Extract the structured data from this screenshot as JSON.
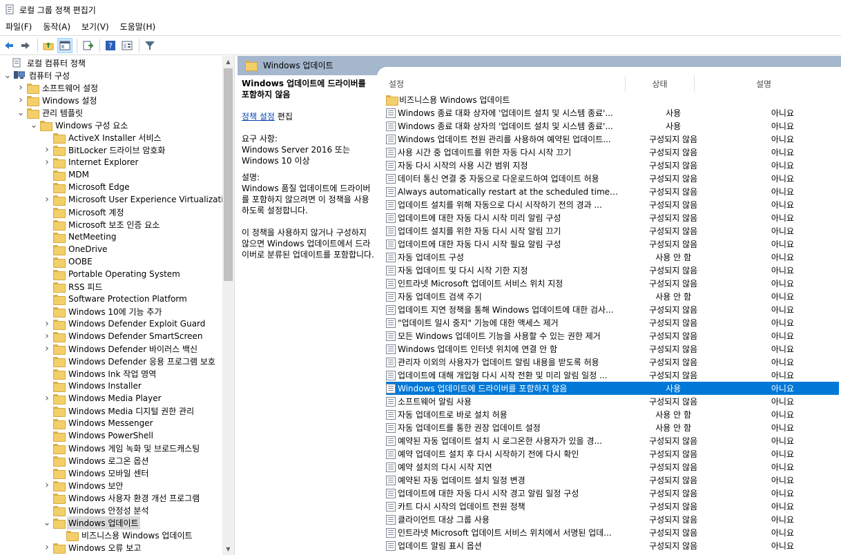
{
  "window": {
    "title": "로컬 그룹 정책 편집기"
  },
  "menu": [
    "파일(F)",
    "동작(A)",
    "보기(V)",
    "도움말(H)"
  ],
  "tree": [
    {
      "label": "로컬 컴퓨터 정책",
      "indent": 0,
      "exp": "",
      "icon": "policy"
    },
    {
      "label": "컴퓨터 구성",
      "indent": 1,
      "exp": "v",
      "icon": "computer"
    },
    {
      "label": "소프트웨어 설정",
      "indent": 2,
      "exp": ">",
      "icon": "folder"
    },
    {
      "label": "Windows 설정",
      "indent": 2,
      "exp": ">",
      "icon": "folder"
    },
    {
      "label": "관리 템플릿",
      "indent": 2,
      "exp": "v",
      "icon": "folder"
    },
    {
      "label": "Windows 구성 요소",
      "indent": 3,
      "exp": "v",
      "icon": "folder"
    },
    {
      "label": "ActiveX Installer 서비스",
      "indent": 4,
      "exp": "",
      "icon": "folder"
    },
    {
      "label": "BitLocker 드라이브 암호화",
      "indent": 4,
      "exp": ">",
      "icon": "folder"
    },
    {
      "label": "Internet Explorer",
      "indent": 4,
      "exp": ">",
      "icon": "folder"
    },
    {
      "label": "MDM",
      "indent": 4,
      "exp": "",
      "icon": "folder"
    },
    {
      "label": "Microsoft Edge",
      "indent": 4,
      "exp": "",
      "icon": "folder"
    },
    {
      "label": "Microsoft User Experience Virtualization",
      "indent": 4,
      "exp": ">",
      "icon": "folder"
    },
    {
      "label": "Microsoft 계정",
      "indent": 4,
      "exp": "",
      "icon": "folder"
    },
    {
      "label": "Microsoft 보조 인증 요소",
      "indent": 4,
      "exp": "",
      "icon": "folder"
    },
    {
      "label": "NetMeeting",
      "indent": 4,
      "exp": "",
      "icon": "folder"
    },
    {
      "label": "OneDrive",
      "indent": 4,
      "exp": "",
      "icon": "folder"
    },
    {
      "label": "OOBE",
      "indent": 4,
      "exp": "",
      "icon": "folder"
    },
    {
      "label": "Portable Operating System",
      "indent": 4,
      "exp": "",
      "icon": "folder"
    },
    {
      "label": "RSS 피드",
      "indent": 4,
      "exp": "",
      "icon": "folder"
    },
    {
      "label": "Software Protection Platform",
      "indent": 4,
      "exp": "",
      "icon": "folder"
    },
    {
      "label": "Windows 10에 기능 추가",
      "indent": 4,
      "exp": "",
      "icon": "folder"
    },
    {
      "label": "Windows Defender Exploit Guard",
      "indent": 4,
      "exp": ">",
      "icon": "folder"
    },
    {
      "label": "Windows Defender SmartScreen",
      "indent": 4,
      "exp": ">",
      "icon": "folder"
    },
    {
      "label": "Windows Defender 바이러스 백신",
      "indent": 4,
      "exp": ">",
      "icon": "folder"
    },
    {
      "label": "Windows Defender 응용 프로그램 보호",
      "indent": 4,
      "exp": "",
      "icon": "folder"
    },
    {
      "label": "Windows Ink 작업 영역",
      "indent": 4,
      "exp": "",
      "icon": "folder"
    },
    {
      "label": "Windows Installer",
      "indent": 4,
      "exp": "",
      "icon": "folder"
    },
    {
      "label": "Windows Media Player",
      "indent": 4,
      "exp": ">",
      "icon": "folder"
    },
    {
      "label": "Windows Media 디지털 권한 관리",
      "indent": 4,
      "exp": "",
      "icon": "folder"
    },
    {
      "label": "Windows Messenger",
      "indent": 4,
      "exp": "",
      "icon": "folder"
    },
    {
      "label": "Windows PowerShell",
      "indent": 4,
      "exp": "",
      "icon": "folder"
    },
    {
      "label": "Windows 게임 녹화 및 브로드캐스팅",
      "indent": 4,
      "exp": "",
      "icon": "folder"
    },
    {
      "label": "Windows 로그온 옵션",
      "indent": 4,
      "exp": "",
      "icon": "folder"
    },
    {
      "label": "Windows 모바일 센터",
      "indent": 4,
      "exp": "",
      "icon": "folder"
    },
    {
      "label": "Windows 보안",
      "indent": 4,
      "exp": ">",
      "icon": "folder"
    },
    {
      "label": "Windows 사용자 환경 개선 프로그램",
      "indent": 4,
      "exp": "",
      "icon": "folder"
    },
    {
      "label": "Windows 안정성 분석",
      "indent": 4,
      "exp": "",
      "icon": "folder"
    },
    {
      "label": "Windows 업데이트",
      "indent": 4,
      "exp": "v",
      "icon": "folder",
      "selected": true
    },
    {
      "label": "비즈니스용 Windows 업데이트",
      "indent": 5,
      "exp": "",
      "icon": "folder"
    },
    {
      "label": "Windows 오류 보고",
      "indent": 4,
      "exp": ">",
      "icon": "folder"
    }
  ],
  "header": {
    "label": "Windows 업데이트"
  },
  "desc": {
    "title": "Windows 업데이트에 드라이버를 포함하지 않음",
    "edit_link": "정책 설정",
    "edit_suffix": " 편집",
    "req_label": "요구 사항:",
    "req_text": "Windows Server 2016 또는 Windows 10 이상",
    "desc_label": "설명:",
    "desc_p1": "Windows 품질 업데이트에 드라이버를 포함하지 않으려면 이 정책을 사용하도록 설정합니다.",
    "desc_p2": "이 정책을 사용하지 않거나 구성하지 않으면 Windows 업데이트에서 드라이버로 분류된 업데이트를 포함합니다."
  },
  "columns": {
    "name": "설정",
    "state": "상태",
    "comment": "설명"
  },
  "rows": [
    {
      "name": "비즈니스용 Windows 업데이트",
      "state": "",
      "comment": "",
      "folder": true
    },
    {
      "name": "Windows 종료 대화 상자에 '업데이트 설치 및 시스템 종료'...",
      "state": "사용",
      "comment": "아니요"
    },
    {
      "name": "Windows 종료 대화 상자의 '업데이트 설치 및 시스템 종료'...",
      "state": "사용",
      "comment": "아니요"
    },
    {
      "name": "Windows 업데이트 전원 관리를 사용하여 예약된 업데이트...",
      "state": "구성되지 않음",
      "comment": "아니요"
    },
    {
      "name": "사용 시간 중 업데이트를 위한 자동 다시 시작 끄기",
      "state": "구성되지 않음",
      "comment": "아니요"
    },
    {
      "name": "자동 다시 시작의 사용 시간 범위 지정",
      "state": "구성되지 않음",
      "comment": "아니요"
    },
    {
      "name": "데이터 통신 연결 중 자동으로 다운로드하여 업데이트 허용",
      "state": "구성되지 않음",
      "comment": "아니요"
    },
    {
      "name": "Always automatically restart at the scheduled time(항상 예...",
      "state": "구성되지 않음",
      "comment": "아니요"
    },
    {
      "name": "업데이트 설치를 위해 자동으로 다시 시작하기 전의 경과 ...",
      "state": "구성되지 않음",
      "comment": "아니요"
    },
    {
      "name": "업데이트에 대한 자동 다시 시작 미리 알림 구성",
      "state": "구성되지 않음",
      "comment": "아니요"
    },
    {
      "name": "업데이트 설치를 위한 자동 다시 시작 알림 끄기",
      "state": "구성되지 않음",
      "comment": "아니요"
    },
    {
      "name": "업데이트에 대한 자동 다시 시작 필요 알림 구성",
      "state": "구성되지 않음",
      "comment": "아니요"
    },
    {
      "name": "자동 업데이트 구성",
      "state": "사용 안 함",
      "comment": "아니요"
    },
    {
      "name": "자동 업데이트 및 다시 시작 기한 지정",
      "state": "구성되지 않음",
      "comment": "아니요"
    },
    {
      "name": "인트라넷 Microsoft 업데이트 서비스 위치 지정",
      "state": "구성되지 않음",
      "comment": "아니요"
    },
    {
      "name": "자동 업데이트 검색 주기",
      "state": "사용 안 함",
      "comment": "아니요"
    },
    {
      "name": "업데이트 지연 정책을 통해 Windows 업데이트에 대한 검사...",
      "state": "구성되지 않음",
      "comment": "아니요"
    },
    {
      "name": "\"업데이트 일시 중지\" 기능에 대한 액세스 제거",
      "state": "구성되지 않음",
      "comment": "아니요"
    },
    {
      "name": "모든 Windows 업데이트 기능을 사용할 수 있는 권한 제거",
      "state": "구성되지 않음",
      "comment": "아니요"
    },
    {
      "name": "Windows 업데이트 인터넷 위치에 연결 안 함",
      "state": "구성되지 않음",
      "comment": "아니요"
    },
    {
      "name": "관리자 이외의 사용자가 업데이트 알림 내용을 받도록 허용",
      "state": "구성되지 않음",
      "comment": "아니요"
    },
    {
      "name": "업데이트에 대해 개입형 다시 시작 전환 및 미리 알림 일정 ...",
      "state": "구성되지 않음",
      "comment": "아니요"
    },
    {
      "name": "Windows 업데이트에 드라이버를 포함하지 않음",
      "state": "사용",
      "comment": "아니요",
      "selected": true
    },
    {
      "name": "소프트웨어 알림 사용",
      "state": "구성되지 않음",
      "comment": "아니요"
    },
    {
      "name": "자동 업데이트로 바로 설치 허용",
      "state": "사용 안 함",
      "comment": "아니요"
    },
    {
      "name": "자동 업데이트를 통한 권장 업데이트 설정",
      "state": "사용 안 함",
      "comment": "아니요"
    },
    {
      "name": "예약된 자동 업데이트 설치 시 로그온한 사용자가 있을 경...",
      "state": "구성되지 않음",
      "comment": "아니요"
    },
    {
      "name": "예약 업데이트 설치 후 다시 시작하기 전에 다시 확인",
      "state": "구성되지 않음",
      "comment": "아니요"
    },
    {
      "name": "예약 설치의 다시 시작 지연",
      "state": "구성되지 않음",
      "comment": "아니요"
    },
    {
      "name": "예약된 자동 업데이트 설치 일정 변경",
      "state": "구성되지 않음",
      "comment": "아니요"
    },
    {
      "name": "업데이트에 대한 자동 다시 시작 경고 알림 일정 구성",
      "state": "구성되지 않음",
      "comment": "아니요"
    },
    {
      "name": "카트 다시 시작의 업데이트 전원 정책",
      "state": "구성되지 않음",
      "comment": "아니요"
    },
    {
      "name": "클라이언트 대상 그룹 사용",
      "state": "구성되지 않음",
      "comment": "아니요"
    },
    {
      "name": "인트라넷 Microsoft 업데이트 서비스 위치에서 서명된 업데...",
      "state": "구성되지 않음",
      "comment": "아니요"
    },
    {
      "name": "업데이트 알림 표시 옵션",
      "state": "구성되지 않음",
      "comment": "아니요"
    }
  ]
}
